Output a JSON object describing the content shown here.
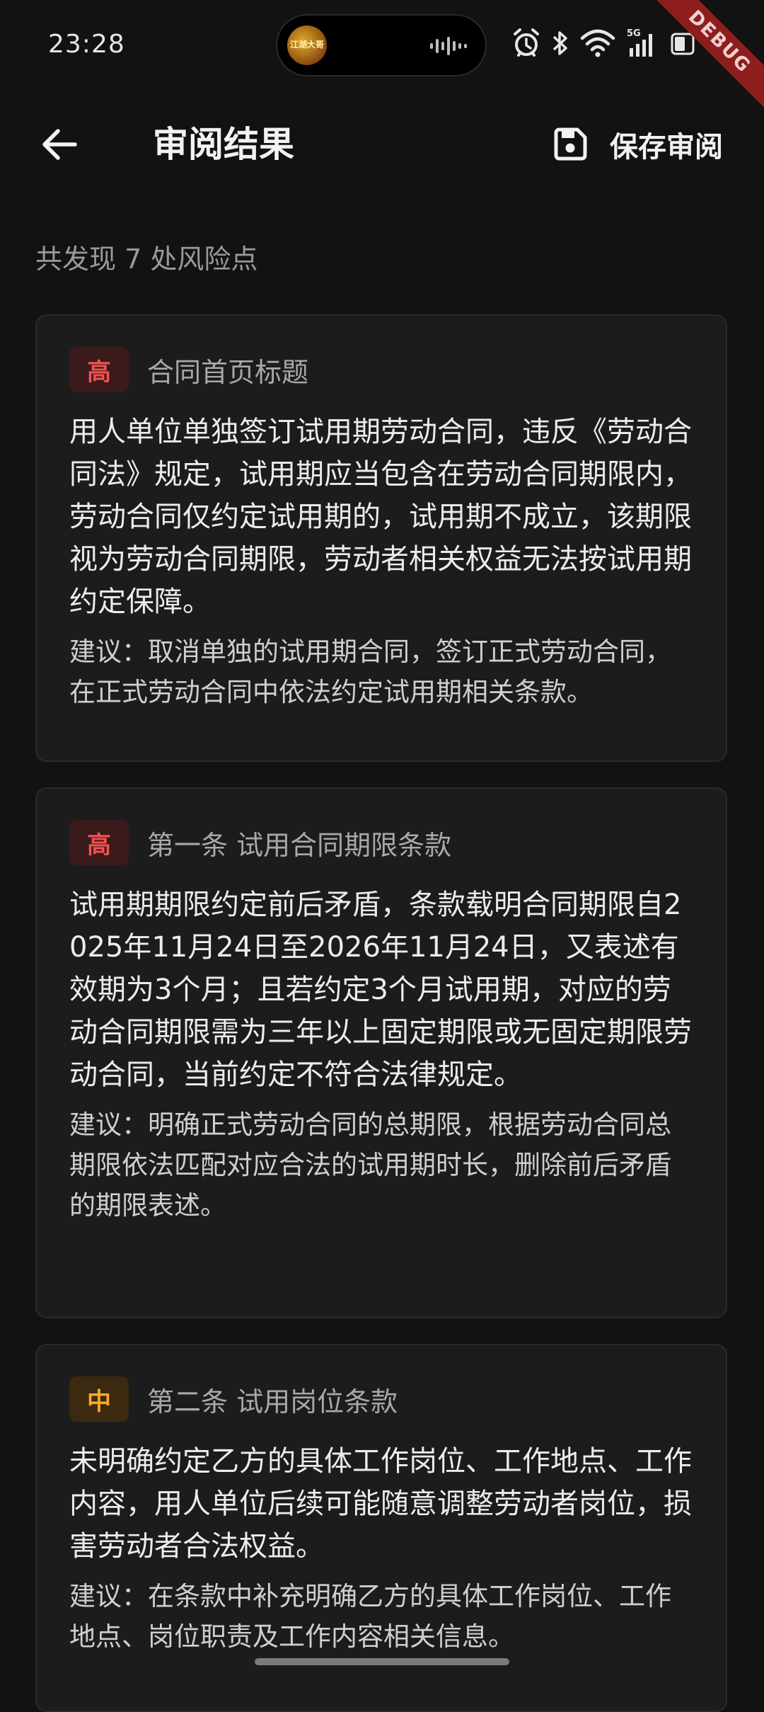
{
  "status_bar": {
    "time": "23:28",
    "island_avatar_text": "江湖大哥",
    "debug_label": "DEBUG",
    "signal_label": "5G"
  },
  "app_bar": {
    "title": "审阅结果",
    "save_label": "保存审阅"
  },
  "summary": "共发现 7 处风险点",
  "issues": [
    {
      "level": "高",
      "title": "合同首页标题",
      "description": "用人单位单独签订试用期劳动合同，违反《劳动合同法》规定，试用期应当包含在劳动合同期限内，劳动合同仅约定试用期的，试用期不成立，该期限视为劳动合同期限，劳动者相关权益无法按试用期约定保障。",
      "suggestion": "建议：取消单独的试用期合同，签订正式劳动合同，在正式劳动合同中依法约定试用期相关条款。"
    },
    {
      "level": "高",
      "title": "第一条 试用合同期限条款",
      "description": "试用期期限约定前后矛盾，条款载明合同期限自2025年11月24日至2026年11月24日，又表述有效期为3个月；且若约定3个月试用期，对应的劳动合同期限需为三年以上固定期限或无固定期限劳动合同，当前约定不符合法律规定。",
      "suggestion": "建议：明确正式劳动合同的总期限，根据劳动合同总期限依法匹配对应合法的试用期时长，删除前后矛盾的期限表述。"
    },
    {
      "level": "中",
      "title": "第二条 试用岗位条款",
      "description": "未明确约定乙方的具体工作岗位、工作地点、工作内容，用人单位后续可能随意调整劳动者岗位，损害劳动者合法权益。",
      "suggestion": "建议：在条款中补充明确乙方的具体工作岗位、工作地点、岗位职责及工作内容相关信息。"
    }
  ],
  "colors": {
    "background": "#121212",
    "card": "#1c1c1d",
    "high": "#ef5350",
    "mid": "#ffa726",
    "debug": "#8e1d1d"
  }
}
